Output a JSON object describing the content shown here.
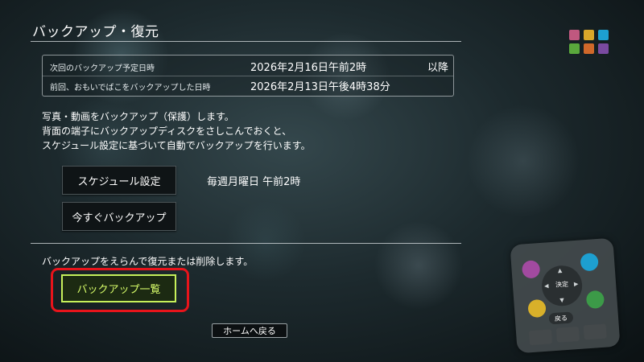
{
  "header": {
    "title": "バックアップ・復元"
  },
  "schedule_info": {
    "next_label": "次回のバックアップ予定日時",
    "next_value": "2026年2月16日午前2時",
    "next_suffix": "以降",
    "last_label": "前回、おもいでばこをバックアップした日時",
    "last_value": "2026年2月13日午後4時38分"
  },
  "description": {
    "line1": "写真・動画をバックアップ（保護）します。",
    "line2": "背面の端子にバックアップディスクをさしこんでおくと、",
    "line3": "スケジュール設定に基づいて自動でバックアップを行います。"
  },
  "schedule": {
    "button_label": "スケジュール設定",
    "value": "毎週月曜日 午前2時"
  },
  "backup_now": {
    "button_label": "今すぐバックアップ"
  },
  "restore": {
    "description": "バックアップをえらんで復元または削除します。",
    "list_button_label": "バックアップ一覧"
  },
  "home_button": {
    "label": "ホームへ戻る"
  },
  "color_grid": [
    "#c0587f",
    "#d8a72a",
    "#1d9fd0",
    "#5aa83c",
    "#d0682a",
    "#7a4aa0"
  ],
  "remote": {
    "center_label": "決定",
    "back_label": "戻る",
    "button_colors": [
      "#a24aa0",
      "#1d9fd0",
      "#d8b02a",
      "#3c9a48"
    ]
  },
  "colors": {
    "focus_border": "#c7f05a",
    "highlight": "#e8141b"
  }
}
